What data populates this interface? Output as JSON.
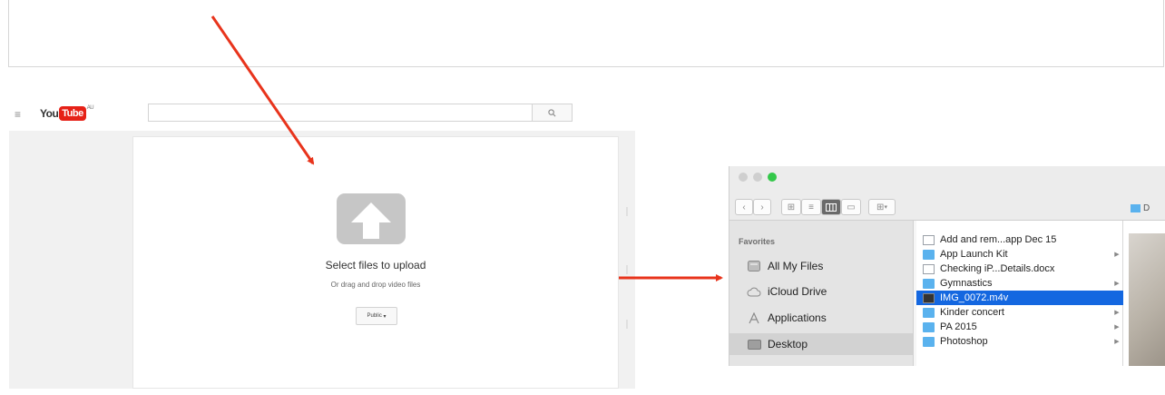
{
  "youtube": {
    "logo_you": "You",
    "logo_tube": "Tube",
    "region": "AU",
    "search_placeholder": "",
    "upload_title": "Select files to upload",
    "upload_subtitle": "Or drag and drop video files",
    "privacy_label": "Public",
    "privacy_caret": "▾"
  },
  "finder": {
    "toolbar": {
      "path_label": "D"
    },
    "sidebar": {
      "heading": "Favorites",
      "items": [
        {
          "label": "All My Files",
          "icon": "all-files-icon"
        },
        {
          "label": "iCloud Drive",
          "icon": "cloud-icon"
        },
        {
          "label": "Applications",
          "icon": "applications-icon"
        },
        {
          "label": "Desktop",
          "icon": "desktop-icon"
        }
      ]
    },
    "files": [
      {
        "name": "Add and rem...app Dec 15",
        "type": "doc",
        "has_children": false
      },
      {
        "name": "App Launch Kit",
        "type": "folder",
        "has_children": true
      },
      {
        "name": "Checking iP...Details.docx",
        "type": "doc",
        "has_children": false
      },
      {
        "name": "Gymnastics",
        "type": "folder",
        "has_children": true
      },
      {
        "name": "IMG_0072.m4v",
        "type": "video",
        "has_children": false
      },
      {
        "name": "Kinder concert",
        "type": "folder",
        "has_children": true
      },
      {
        "name": "PA 2015",
        "type": "folder",
        "has_children": true
      },
      {
        "name": "Photoshop",
        "type": "folder",
        "has_children": true
      }
    ],
    "selected_file": "IMG_0072.m4v"
  },
  "colors": {
    "annotation_arrow": "#e8341c",
    "youtube_red": "#e62117",
    "finder_selection": "#1467e0"
  }
}
